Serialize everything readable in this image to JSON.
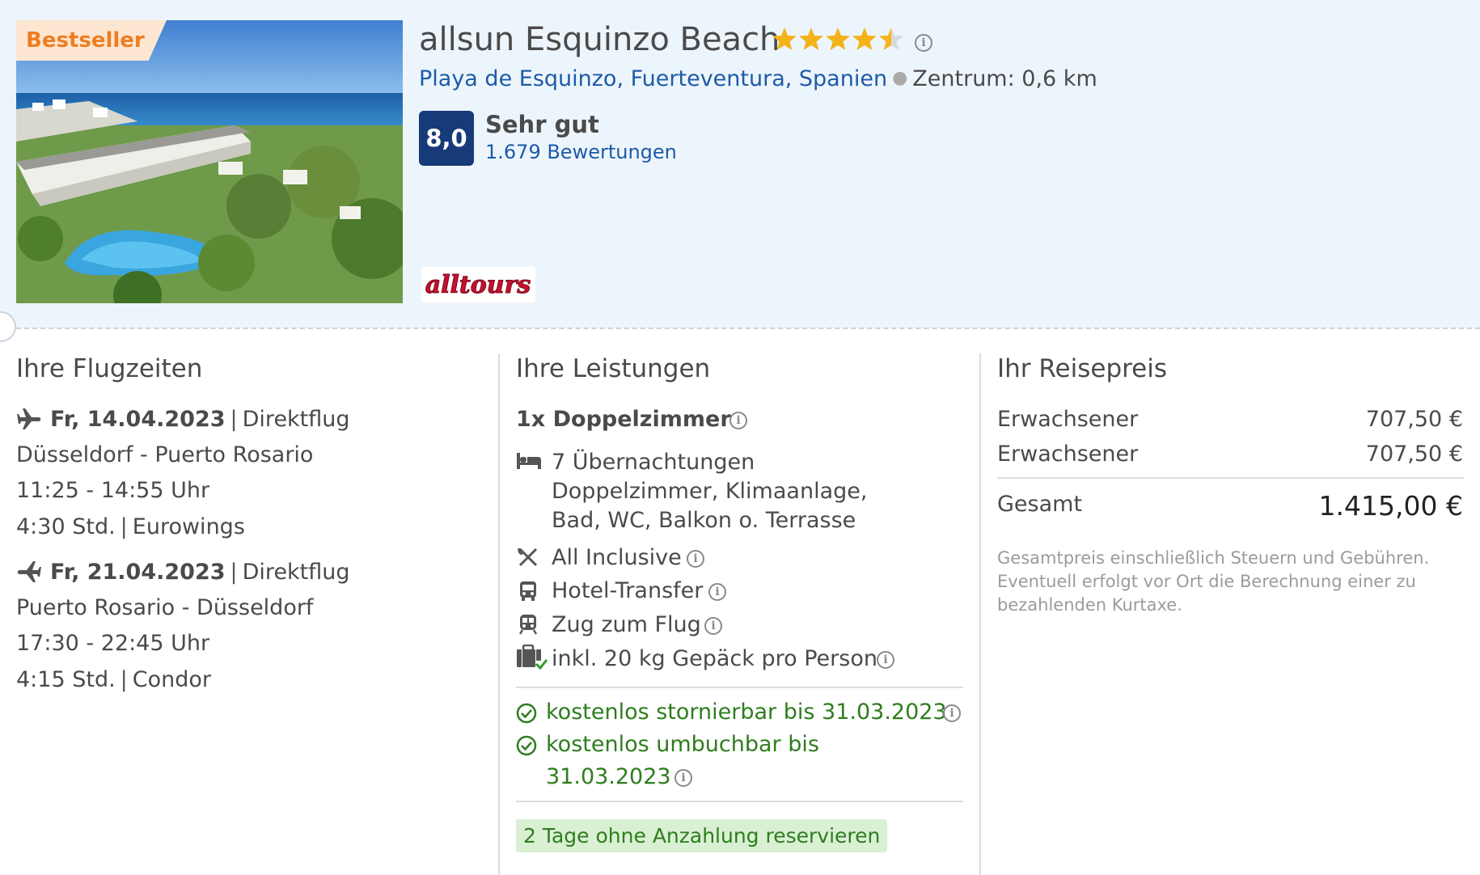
{
  "hotel": {
    "badge": "Bestseller",
    "name": "allsun Esquinzo Beach",
    "stars": 4.5,
    "location": "Playa de Esquinzo, Fuerteventura, Spanien",
    "distance": "Zentrum: 0,6 km",
    "score": "8,0",
    "rating_text": "Sehr gut",
    "reviews": "1.679 Bewertungen",
    "operator": "alltours"
  },
  "flights": {
    "title": "Ihre Flugzeiten",
    "outbound": {
      "date": "Fr, 14.04.2023",
      "type": "Direktflug",
      "route": "Düsseldorf - Puerto Rosario",
      "times": "11:25 - 14:55 Uhr",
      "duration": "4:30 Std.",
      "airline": "Eurowings"
    },
    "return": {
      "date": "Fr, 21.04.2023",
      "type": "Direktflug",
      "route": "Puerto Rosario - Düsseldorf",
      "times": "17:30 - 22:45 Uhr",
      "duration": "4:15 Std.",
      "airline": "Condor"
    },
    "separator": "|"
  },
  "services": {
    "title": "Ihre Leistungen",
    "room": "1x Doppelzimmer",
    "nights": "7 Übernachtungen",
    "room_desc_1": "Doppelzimmer, Klimaanlage,",
    "room_desc_2": "Bad, WC, Balkon o. Terrasse",
    "board": "All Inclusive",
    "transfer": "Hotel-Transfer",
    "train": "Zug zum Flug",
    "luggage": "inkl. 20 kg Gepäck pro Person",
    "cancel": "kostenlos stornierbar bis 31.03.2023",
    "rebook_1": "kostenlos umbuchbar bis",
    "rebook_2": "31.03.2023",
    "reserve": "2 Tage ohne Anzahlung reservieren"
  },
  "price": {
    "title": "Ihr Reisepreis",
    "rows": [
      {
        "label": "Erwachsener",
        "value": "707,50 €"
      },
      {
        "label": "Erwachsener",
        "value": "707,50 €"
      }
    ],
    "total_label": "Gesamt",
    "total_value": "1.415,00 €",
    "note": "Gesamtpreis einschließlich Steuern und Gebühren. Eventuell erfolgt vor Ort die Berechnung einer zu bezahlenden Kurtaxe."
  },
  "colors": {
    "link": "#1d5aa8",
    "score_badge": "#173a78",
    "green": "#2e7d1e",
    "badge_orange": "#ee7d22"
  },
  "icons": {
    "stars": "star-icon",
    "outbound": "plane-departure-icon",
    "return": "plane-return-icon",
    "bed": "bed-icon",
    "board": "cutlery-icon",
    "transfer": "bus-icon",
    "train": "train-icon",
    "luggage": "luggage-check-icon",
    "check": "check-circle-icon",
    "info": "info-icon"
  }
}
